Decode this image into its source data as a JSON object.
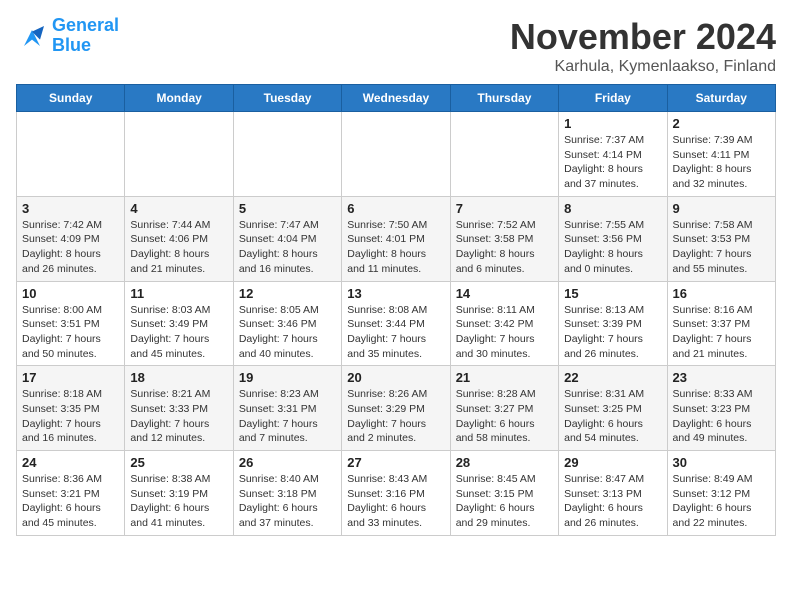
{
  "logo": {
    "line1": "General",
    "line2": "Blue"
  },
  "title": "November 2024",
  "location": "Karhula, Kymenlaakso, Finland",
  "weekdays": [
    "Sunday",
    "Monday",
    "Tuesday",
    "Wednesday",
    "Thursday",
    "Friday",
    "Saturday"
  ],
  "weeks": [
    [
      {
        "day": "",
        "info": ""
      },
      {
        "day": "",
        "info": ""
      },
      {
        "day": "",
        "info": ""
      },
      {
        "day": "",
        "info": ""
      },
      {
        "day": "",
        "info": ""
      },
      {
        "day": "1",
        "info": "Sunrise: 7:37 AM\nSunset: 4:14 PM\nDaylight: 8 hours\nand 37 minutes."
      },
      {
        "day": "2",
        "info": "Sunrise: 7:39 AM\nSunset: 4:11 PM\nDaylight: 8 hours\nand 32 minutes."
      }
    ],
    [
      {
        "day": "3",
        "info": "Sunrise: 7:42 AM\nSunset: 4:09 PM\nDaylight: 8 hours\nand 26 minutes."
      },
      {
        "day": "4",
        "info": "Sunrise: 7:44 AM\nSunset: 4:06 PM\nDaylight: 8 hours\nand 21 minutes."
      },
      {
        "day": "5",
        "info": "Sunrise: 7:47 AM\nSunset: 4:04 PM\nDaylight: 8 hours\nand 16 minutes."
      },
      {
        "day": "6",
        "info": "Sunrise: 7:50 AM\nSunset: 4:01 PM\nDaylight: 8 hours\nand 11 minutes."
      },
      {
        "day": "7",
        "info": "Sunrise: 7:52 AM\nSunset: 3:58 PM\nDaylight: 8 hours\nand 6 minutes."
      },
      {
        "day": "8",
        "info": "Sunrise: 7:55 AM\nSunset: 3:56 PM\nDaylight: 8 hours\nand 0 minutes."
      },
      {
        "day": "9",
        "info": "Sunrise: 7:58 AM\nSunset: 3:53 PM\nDaylight: 7 hours\nand 55 minutes."
      }
    ],
    [
      {
        "day": "10",
        "info": "Sunrise: 8:00 AM\nSunset: 3:51 PM\nDaylight: 7 hours\nand 50 minutes."
      },
      {
        "day": "11",
        "info": "Sunrise: 8:03 AM\nSunset: 3:49 PM\nDaylight: 7 hours\nand 45 minutes."
      },
      {
        "day": "12",
        "info": "Sunrise: 8:05 AM\nSunset: 3:46 PM\nDaylight: 7 hours\nand 40 minutes."
      },
      {
        "day": "13",
        "info": "Sunrise: 8:08 AM\nSunset: 3:44 PM\nDaylight: 7 hours\nand 35 minutes."
      },
      {
        "day": "14",
        "info": "Sunrise: 8:11 AM\nSunset: 3:42 PM\nDaylight: 7 hours\nand 30 minutes."
      },
      {
        "day": "15",
        "info": "Sunrise: 8:13 AM\nSunset: 3:39 PM\nDaylight: 7 hours\nand 26 minutes."
      },
      {
        "day": "16",
        "info": "Sunrise: 8:16 AM\nSunset: 3:37 PM\nDaylight: 7 hours\nand 21 minutes."
      }
    ],
    [
      {
        "day": "17",
        "info": "Sunrise: 8:18 AM\nSunset: 3:35 PM\nDaylight: 7 hours\nand 16 minutes."
      },
      {
        "day": "18",
        "info": "Sunrise: 8:21 AM\nSunset: 3:33 PM\nDaylight: 7 hours\nand 12 minutes."
      },
      {
        "day": "19",
        "info": "Sunrise: 8:23 AM\nSunset: 3:31 PM\nDaylight: 7 hours\nand 7 minutes."
      },
      {
        "day": "20",
        "info": "Sunrise: 8:26 AM\nSunset: 3:29 PM\nDaylight: 7 hours\nand 2 minutes."
      },
      {
        "day": "21",
        "info": "Sunrise: 8:28 AM\nSunset: 3:27 PM\nDaylight: 6 hours\nand 58 minutes."
      },
      {
        "day": "22",
        "info": "Sunrise: 8:31 AM\nSunset: 3:25 PM\nDaylight: 6 hours\nand 54 minutes."
      },
      {
        "day": "23",
        "info": "Sunrise: 8:33 AM\nSunset: 3:23 PM\nDaylight: 6 hours\nand 49 minutes."
      }
    ],
    [
      {
        "day": "24",
        "info": "Sunrise: 8:36 AM\nSunset: 3:21 PM\nDaylight: 6 hours\nand 45 minutes."
      },
      {
        "day": "25",
        "info": "Sunrise: 8:38 AM\nSunset: 3:19 PM\nDaylight: 6 hours\nand 41 minutes."
      },
      {
        "day": "26",
        "info": "Sunrise: 8:40 AM\nSunset: 3:18 PM\nDaylight: 6 hours\nand 37 minutes."
      },
      {
        "day": "27",
        "info": "Sunrise: 8:43 AM\nSunset: 3:16 PM\nDaylight: 6 hours\nand 33 minutes."
      },
      {
        "day": "28",
        "info": "Sunrise: 8:45 AM\nSunset: 3:15 PM\nDaylight: 6 hours\nand 29 minutes."
      },
      {
        "day": "29",
        "info": "Sunrise: 8:47 AM\nSunset: 3:13 PM\nDaylight: 6 hours\nand 26 minutes."
      },
      {
        "day": "30",
        "info": "Sunrise: 8:49 AM\nSunset: 3:12 PM\nDaylight: 6 hours\nand 22 minutes."
      }
    ]
  ]
}
